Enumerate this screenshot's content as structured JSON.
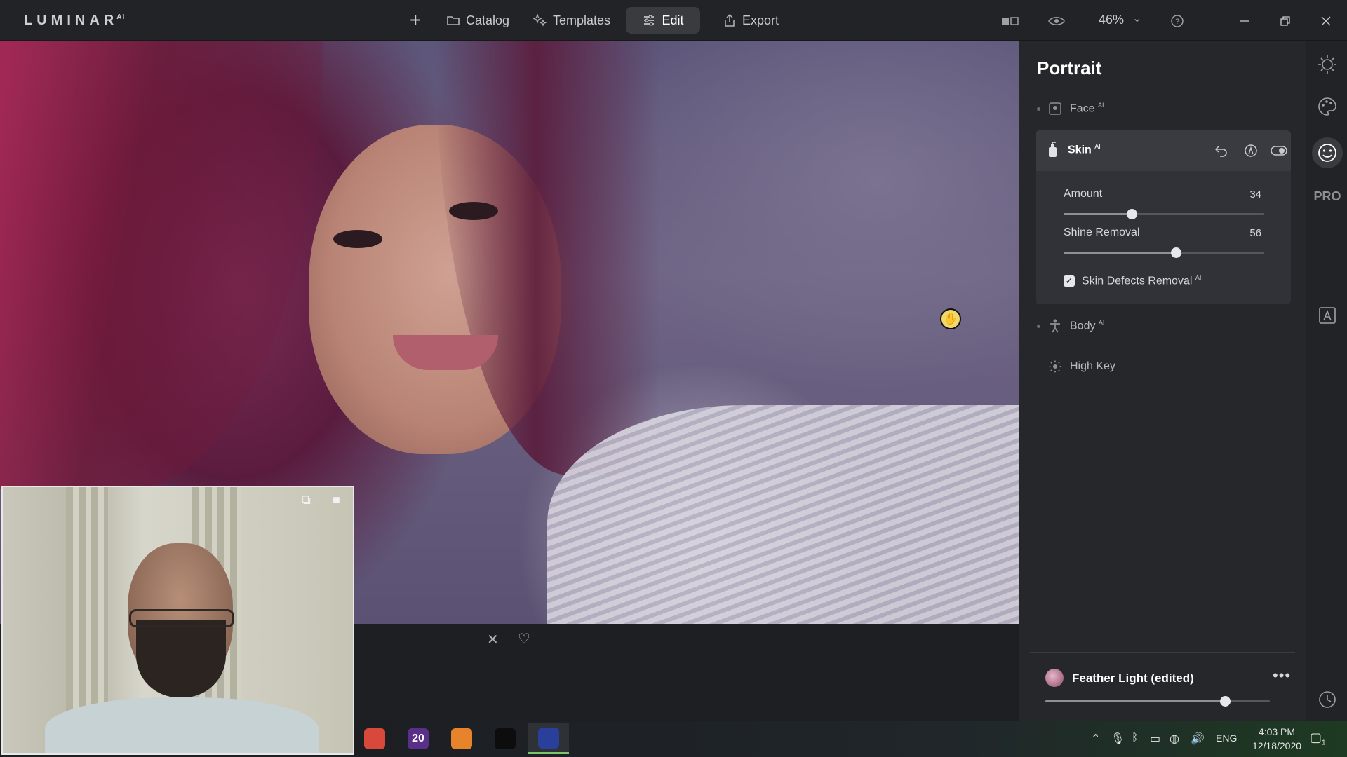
{
  "app": {
    "logo": "LUMINAR",
    "logo_suffix": "AI"
  },
  "nav": {
    "catalog": "Catalog",
    "templates": "Templates",
    "edit": "Edit",
    "export": "Export"
  },
  "view": {
    "zoom": "46%"
  },
  "panel": {
    "title": "Portrait",
    "tools": {
      "face": {
        "label": "Face",
        "badge": "AI"
      },
      "skin": {
        "label": "Skin",
        "badge": "AI",
        "amount": {
          "label": "Amount",
          "value": 34
        },
        "shine_removal": {
          "label": "Shine Removal",
          "value": 56
        },
        "defects": {
          "label": "Skin Defects Removal",
          "badge": "AI",
          "checked": true
        }
      },
      "body": {
        "label": "Body",
        "badge": "AI"
      },
      "high_key": {
        "label": "High Key"
      }
    },
    "preset": {
      "name": "Feather Light (edited)",
      "amount": 0.8,
      "more": "•••"
    }
  },
  "rail": {
    "pro_label": "PRO"
  },
  "taskbar": {
    "apps": [
      {
        "name": "app-1",
        "glyph": "",
        "color": "#d8493b"
      },
      {
        "name": "app-2",
        "glyph": "20",
        "color": "#5a2f8a"
      },
      {
        "name": "app-3",
        "glyph": "",
        "color": "#e7832b"
      },
      {
        "name": "app-4",
        "glyph": "",
        "color": "#0d0d0d"
      },
      {
        "name": "luminar",
        "glyph": "",
        "color": "#2a3f9a"
      }
    ],
    "language": "ENG",
    "time": "4:03 PM",
    "date": "12/18/2020",
    "notifications": "1"
  }
}
